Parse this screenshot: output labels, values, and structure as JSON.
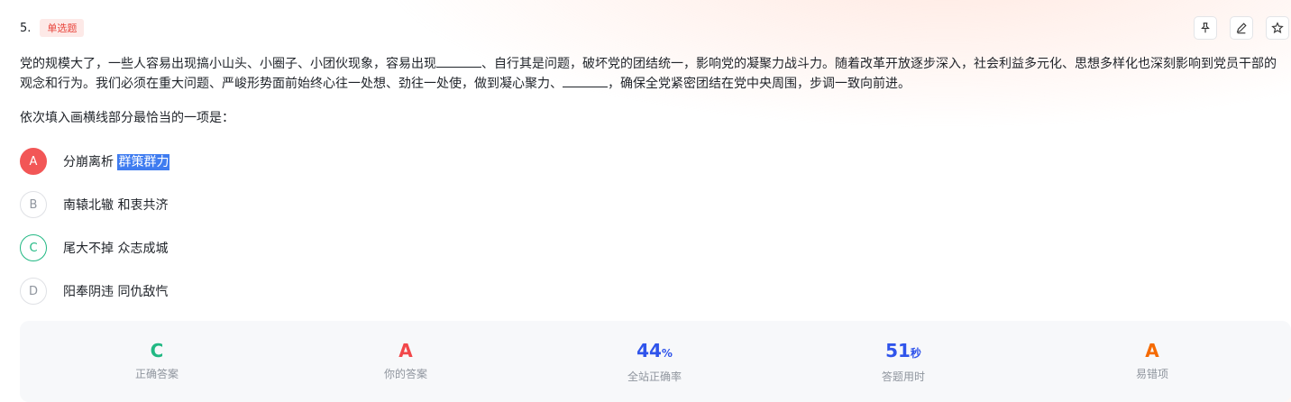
{
  "question": {
    "number": "5.",
    "type_tag": "单选题",
    "stem_part1": "党的规模大了，一些人容易出现搞小山头、小圈子、小团伙现象，容易出现",
    "stem_part2": "、自行其是问题，破坏党的团结统一，影响党的凝聚力战斗力。随着改革开放逐步深入，社会利益多元化、思想多样化也深刻影响到党员干部的观念和行为。我们必须在重大问题、严峻形势面前始终心往一处想、劲往一处使，做到凝心聚力、",
    "stem_part3": "，确保全党紧密团结在党中央周围，步调一致向前进。",
    "prompt": "依次填入画横线部分最恰当的一项是："
  },
  "toolbar": {
    "pin_icon": "pin-icon",
    "edit_icon": "pencil-icon",
    "star_icon": "star-icon"
  },
  "options": [
    {
      "letter": "A",
      "text_a": "分崩离析",
      "text_b": "群策群力",
      "state": "wrong"
    },
    {
      "letter": "B",
      "text_a": "南辕北辙",
      "text_b": "和衷共济",
      "state": "normal"
    },
    {
      "letter": "C",
      "text_a": "尾大不掉",
      "text_b": "众志成城",
      "state": "correct"
    },
    {
      "letter": "D",
      "text_a": "阳奉阴违",
      "text_b": "同仇敌忾",
      "state": "normal"
    }
  ],
  "stats": {
    "correct_answer": {
      "value": "C",
      "label": "正确答案",
      "color": "#21b883"
    },
    "your_answer": {
      "value": "A",
      "label": "你的答案",
      "color": "#f2474a"
    },
    "accuracy": {
      "value": "44",
      "unit": "%",
      "label": "全站正确率",
      "color": "#2f54eb"
    },
    "time": {
      "value": "51",
      "unit": "秒",
      "label": "答题用时",
      "color": "#2f54eb"
    },
    "common_wrong": {
      "value": "A",
      "label": "易错项",
      "color": "#f56a00"
    }
  }
}
